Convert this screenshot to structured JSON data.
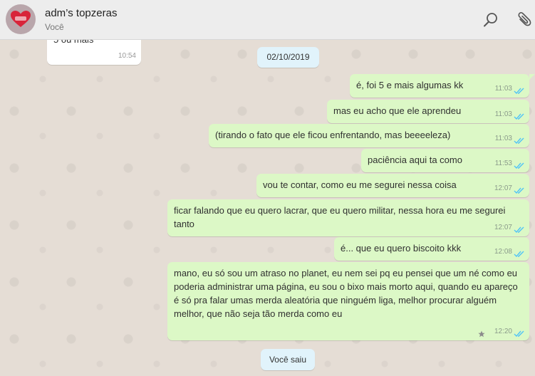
{
  "header": {
    "title": "adm’s topzeras",
    "subtitle": "Você",
    "icons": [
      "search-icon",
      "attach-icon"
    ]
  },
  "chat": {
    "prev_message": {
      "text": "5 ou mais",
      "time": "10:54"
    },
    "date_divider": "02/10/2019",
    "messages": [
      {
        "text": "é, foi 5 e mais algumas kk",
        "time": "11:03"
      },
      {
        "text": "mas eu acho que ele aprendeu",
        "time": "11:03"
      },
      {
        "text": "(tirando o fato que ele ficou enfrentando, mas beeeeleza)",
        "time": "11:03"
      },
      {
        "text": "paciência aqui ta como",
        "time": "11:53"
      },
      {
        "text": "vou te contar, como eu me segurei nessa coisa",
        "time": "12:07"
      },
      {
        "text": "ficar falando que eu quero lacrar, que eu quero militar, nessa hora eu me segurei tanto",
        "time": "12:07"
      },
      {
        "text": "é... que eu quero biscoito kkk",
        "time": "12:08"
      },
      {
        "text": "mano, eu só sou um atraso no planet, eu nem sei pq eu pensei que um né como eu poderia administrar uma página, eu sou o bixo mais morto aqui, quando eu apareço é só pra falar umas merda aleatória que ninguém liga, melhor procurar alguém melhor, que não seja tão merda como eu",
        "time": "12:20",
        "starred": true
      }
    ],
    "system_message": "Você saiu"
  },
  "colors": {
    "outgoing_bubble": "#dcf8c6",
    "incoming_bubble": "#ffffff",
    "chat_background": "#e5ddd5",
    "read_ticks": "#4fc3f7",
    "header_background": "#ededed"
  }
}
